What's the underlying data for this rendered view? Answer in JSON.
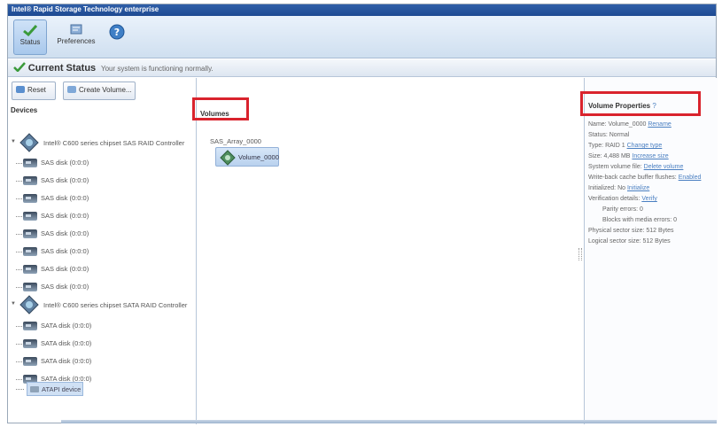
{
  "window": {
    "title": "Intel® Rapid Storage Technology enterprise"
  },
  "toolbar": {
    "buttons": [
      {
        "label": "Status",
        "icon": "status-icon"
      },
      {
        "label": "Preferences",
        "icon": "preferences-icon"
      },
      {
        "label": "",
        "icon": "help-icon"
      }
    ]
  },
  "status": {
    "title": "Current Status",
    "subtitle": "Your system is functioning normally."
  },
  "devices": {
    "reset_label": "Reset",
    "reset_icon": "reset-icon",
    "volume_creation_label": "Create Volume...",
    "volume_creation_icon": "create-volume-icon",
    "header": "Devices",
    "controller1": "Intel® C600 series chipset SAS RAID Controller",
    "sas_disks": [
      "SAS disk (0:0:0)",
      "SAS disk (0:0:0)",
      "SAS disk (0:0:0)",
      "SAS disk (0:0:0)",
      "SAS disk (0:0:0)",
      "SAS disk (0:0:0)",
      "SAS disk (0:0:0)",
      "SAS disk (0:0:0)"
    ],
    "controller2": "Intel® C600 series chipset SATA RAID Controller",
    "sata_disks": [
      "SATA disk (0:0:0)",
      "SATA disk (0:0:0)",
      "SATA disk (0:0:0)",
      "SATA disk (0:0:0)"
    ],
    "atapi_label": "ATAPI device"
  },
  "volumes": {
    "header": "Volumes",
    "array_label": "SAS_Array_0000",
    "volume_label": "Volume_0000",
    "highlight_color": "#d9232d"
  },
  "properties": {
    "title": "Volume Properties",
    "help_glyph": "?",
    "lines": [
      {
        "text": "Name: Volume_0000",
        "link": "Rename",
        "indent": false
      },
      {
        "text": "Status: Normal",
        "link": "",
        "indent": false
      },
      {
        "text": "Type: RAID 1",
        "link": "Change type",
        "indent": false
      },
      {
        "text": "Size: 4,488 MB",
        "link": "Increase size",
        "indent": false
      },
      {
        "text": "System volume file:",
        "link": "Delete volume",
        "indent": false
      },
      {
        "text": "Write-back cache buffer flushes:",
        "link": "Enabled",
        "indent": false
      },
      {
        "text": "Initialized: No",
        "link": "Initialize",
        "indent": false
      },
      {
        "text": "Verification details:",
        "link": "Verify",
        "indent": false
      },
      {
        "text": "Parity errors: 0",
        "link": "",
        "indent": true
      },
      {
        "text": "Blocks with media errors: 0",
        "link": "",
        "indent": true
      },
      {
        "text": "Physical sector size: 512 Bytes",
        "link": "",
        "indent": false
      },
      {
        "text": "Logical sector size: 512 Bytes",
        "link": "",
        "indent": false
      }
    ]
  }
}
